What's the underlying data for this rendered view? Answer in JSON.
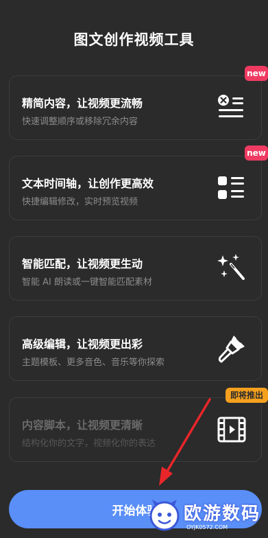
{
  "header": {
    "title": "图文创作视频工具"
  },
  "cards": [
    {
      "title": "精简内容，让视频更流畅",
      "subtitle": "快速调整顺序或移除冗余内容",
      "icon": "remove-list-icon",
      "badge": "new"
    },
    {
      "title": "文本时间轴，让创作更高效",
      "subtitle": "快捷编辑修改，实时预览视频",
      "icon": "timeline-list-icon",
      "badge": "new"
    },
    {
      "title": "智能匹配，让视频更生动",
      "subtitle": "智能 AI 朗读或一键智能匹配素材",
      "icon": "magic-wand-icon",
      "badge": ""
    },
    {
      "title": "高级编辑，让视频更出彩",
      "subtitle": "主题模板、更多音色、音乐等你探索",
      "icon": "paint-brush-icon",
      "badge": ""
    },
    {
      "title": "内容脚本，让视频更清晰",
      "subtitle": "结构化你的文字，视频化你的表达",
      "icon": "film-icon",
      "badge": "即将推出"
    }
  ],
  "start_button": {
    "label": "开始体验"
  },
  "watermark": {
    "text": "欧游数码",
    "url": "OYJK0572.COM"
  },
  "colors": {
    "background": "#2b2b2b",
    "accent": "#5a8ff8",
    "new_badge": "#ef3b62",
    "soon_badge": "#f5a01e",
    "arrow": "#e8262a"
  }
}
